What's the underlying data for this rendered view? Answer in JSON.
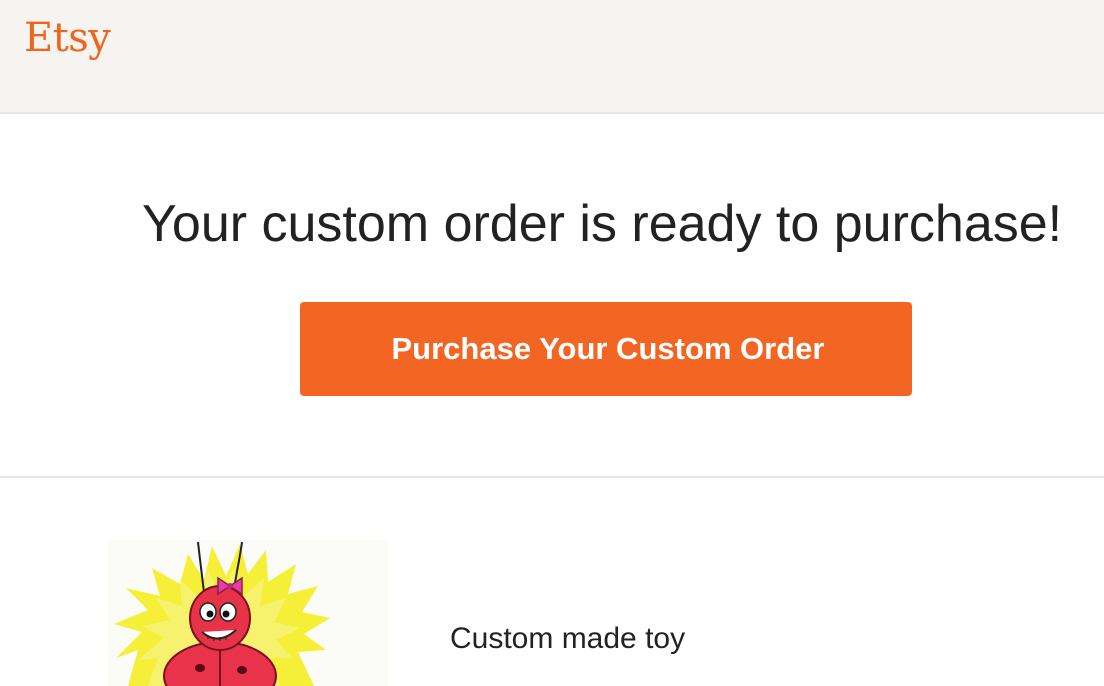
{
  "header": {
    "logo_text": "Etsy",
    "brand_color": "#F1641E"
  },
  "main": {
    "headline": "Your custom order is ready to purchase!",
    "cta_label": "Purchase Your Custom Order",
    "cta_color": "#F26522"
  },
  "product": {
    "image_icon": "cartoon-ladybug-toy-illustration",
    "title": "Custom made toy"
  }
}
